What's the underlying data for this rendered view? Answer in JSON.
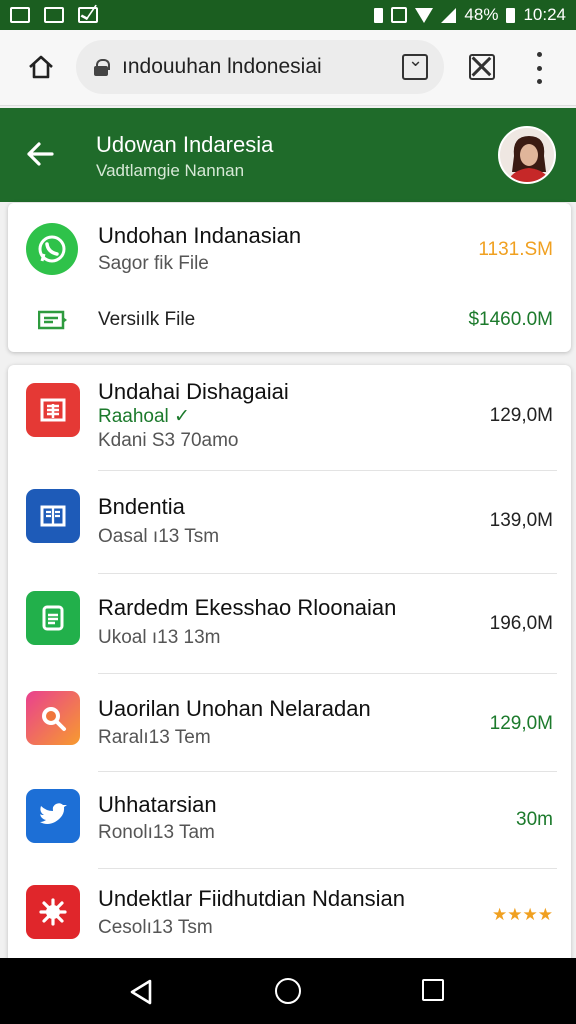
{
  "status_bar": {
    "battery_text": "48%",
    "time": "10:24"
  },
  "browser": {
    "url": "ındouuhan lndonesiai"
  },
  "header": {
    "title": "Udowan Indaresia",
    "subtitle": "Vadtlamgie Nannan"
  },
  "card1": {
    "row1": {
      "title": "Undohan Indanasian",
      "subtitle": "Sagor fik File",
      "size": "1131.SM"
    },
    "row2": {
      "title": "Versiılk File",
      "size": "$1460.0M"
    }
  },
  "list": [
    {
      "title": "Undahai Dishagaiai",
      "tag": "Raahoal ✓",
      "subtitle": "Kdani S3 70amo",
      "size": "129,0M",
      "icon": "document-icon",
      "color": "#e53935"
    },
    {
      "title": "Bndentia",
      "subtitle": "Oasal ı13 Tsm",
      "size": "139,0M",
      "icon": "document-icon",
      "color": "#1e5bb8"
    },
    {
      "title": "Rardedm Ekesshao Rloonaian",
      "subtitle": "Ukoal ı13 13m",
      "size": "196,0M",
      "icon": "note-icon",
      "color": "#22b04b"
    },
    {
      "title": "Uaorilan Unohan Nelaradan",
      "subtitle": "Raralı13 Tem",
      "size": "129,0M",
      "icon": "search-icon",
      "color": "#f0763c"
    },
    {
      "title": "Uhhatarsian",
      "subtitle": "Ronolı13 Tam",
      "size": "30m",
      "icon": "bird-icon",
      "color": "#1d6fd6"
    },
    {
      "title": "Undektlar Fiidhutdian Ndansian",
      "subtitle": "Cesolı13 Tsm",
      "size": "★★★★",
      "icon": "gear-icon",
      "color": "#e0262b"
    }
  ],
  "colors": {
    "status_bar": "#1b5e20",
    "header": "#1f6b2a",
    "size_orange": "#f0a020",
    "size_green": "#1c7a2c"
  }
}
